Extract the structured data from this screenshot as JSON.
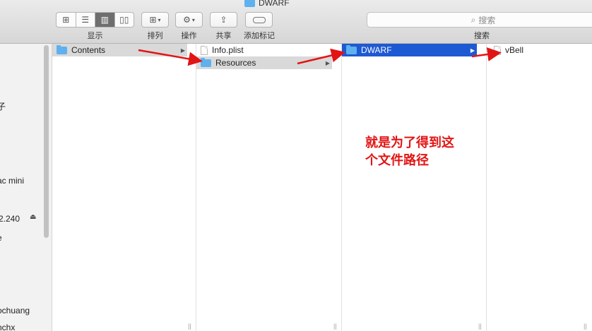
{
  "window": {
    "title": "DWARF"
  },
  "toolbar": {
    "view_label": "显示",
    "arrange_label": "排列",
    "action_label": "操作",
    "share_label": "共享",
    "tag_label": "添加标记",
    "search_placeholder": "搜索",
    "search_label": "搜索"
  },
  "sidebar": {
    "items": [
      "子",
      "ac mini",
      "2.240",
      "e",
      "ochuang",
      "nchx"
    ]
  },
  "columns": {
    "col1": {
      "items": [
        "Contents"
      ]
    },
    "col2": {
      "items": [
        "Info.plist",
        "Resources"
      ]
    },
    "col3": {
      "items": [
        "DWARF"
      ]
    },
    "col4": {
      "items": [
        "vBell"
      ]
    }
  },
  "annotation": {
    "line1": "就是为了得到这",
    "line2": "个文件路径"
  },
  "colors": {
    "selection_blue": "#1d59d2",
    "selection_grey": "#d9d9d9",
    "annotation_red": "#e21515",
    "folder_blue": "#5eb1ee"
  }
}
